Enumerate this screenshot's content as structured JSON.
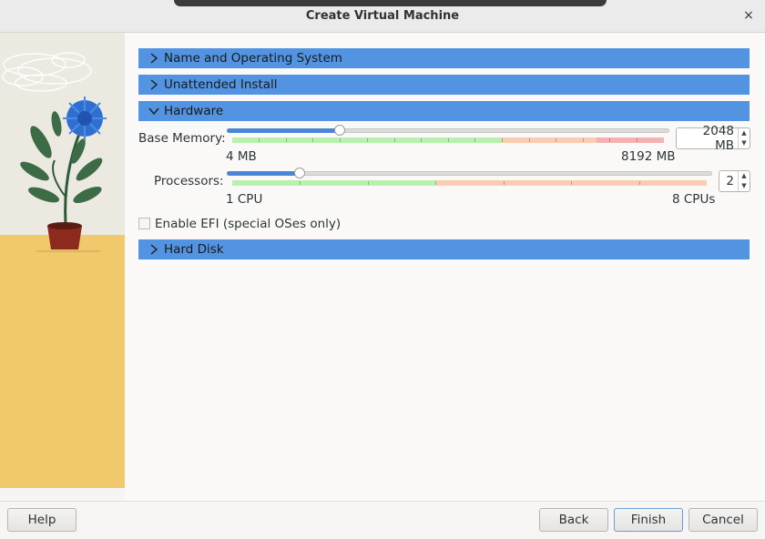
{
  "window": {
    "title": "Create Virtual Machine",
    "close_glyph": "×"
  },
  "sections": [
    {
      "label": "Name and Operating System",
      "expanded": false
    },
    {
      "label": "Unattended Install",
      "expanded": false
    },
    {
      "label": "Hardware",
      "expanded": true
    },
    {
      "label": "Hard Disk",
      "expanded": false
    }
  ],
  "hardware": {
    "memory": {
      "label": "Base Memory:",
      "value": "2048 MB",
      "min_label": "4 MB",
      "max_label": "8192 MB",
      "level_fraction": 0.25
    },
    "processors": {
      "label": "Processors:",
      "value": "2",
      "min_label": "1 CPU",
      "max_label": "8 CPUs",
      "level_fraction": 0.14
    },
    "efi": {
      "label": "Enable EFI (special OSes only)",
      "checked": false
    }
  },
  "buttons": {
    "help": "Help",
    "back": "Back",
    "finish": "Finish",
    "cancel": "Cancel"
  },
  "colors": {
    "section_bar": "#5294e2",
    "scale_green": "#b9f0b0",
    "scale_orange": "#f9cdb5",
    "scale_red": "#f4b3b3",
    "slider_fill": "#4a86d4"
  }
}
